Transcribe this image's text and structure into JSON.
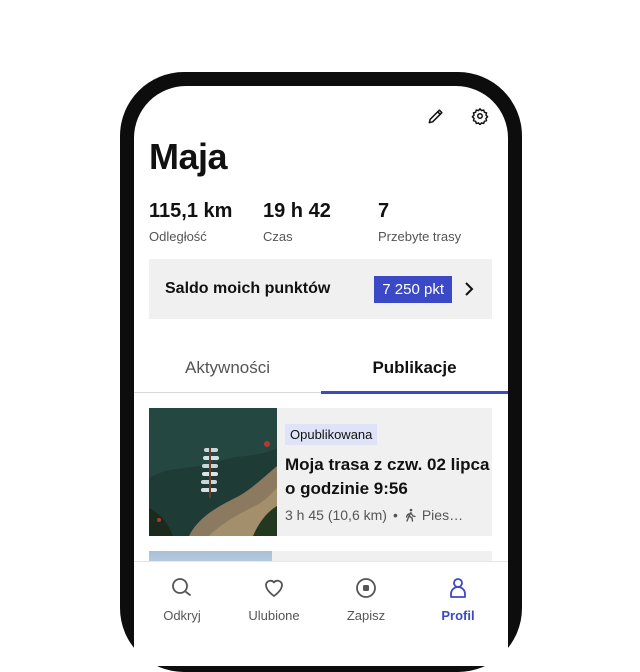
{
  "profile": {
    "name": "Maja"
  },
  "header": {
    "edit_icon": "pencil-icon",
    "settings_icon": "gear-icon"
  },
  "stats": [
    {
      "value": "115,1 km",
      "label": "Odległość"
    },
    {
      "value": "19 h 42",
      "label": "Czas"
    },
    {
      "value": "7",
      "label": "Przebyte trasy"
    }
  ],
  "points": {
    "label": "Saldo moich punktów",
    "value": "7 250 pkt",
    "icon": "chevron-right-icon"
  },
  "tabs": [
    {
      "label": "Aktywności",
      "active": false
    },
    {
      "label": "Publikacje",
      "active": true
    }
  ],
  "publications": [
    {
      "status": "Opublikowana",
      "title": "Moja trasa z czw. 02 lipca o godzinie 9:56",
      "duration": "3 h 45 (10,6 km)",
      "separator": "•",
      "activity": "Pies…",
      "activity_icon": "walking-icon"
    }
  ],
  "nav": [
    {
      "label": "Odkryj",
      "icon": "search-icon",
      "active": false
    },
    {
      "label": "Ulubione",
      "icon": "heart-icon",
      "active": false
    },
    {
      "label": "Zapisz",
      "icon": "record-icon",
      "active": false
    },
    {
      "label": "Profil",
      "icon": "person-icon",
      "active": true
    }
  ],
  "colors": {
    "accent": "#3b49c7",
    "badge_bg": "#dfe3f7",
    "card_bg": "#f0f0f0"
  }
}
